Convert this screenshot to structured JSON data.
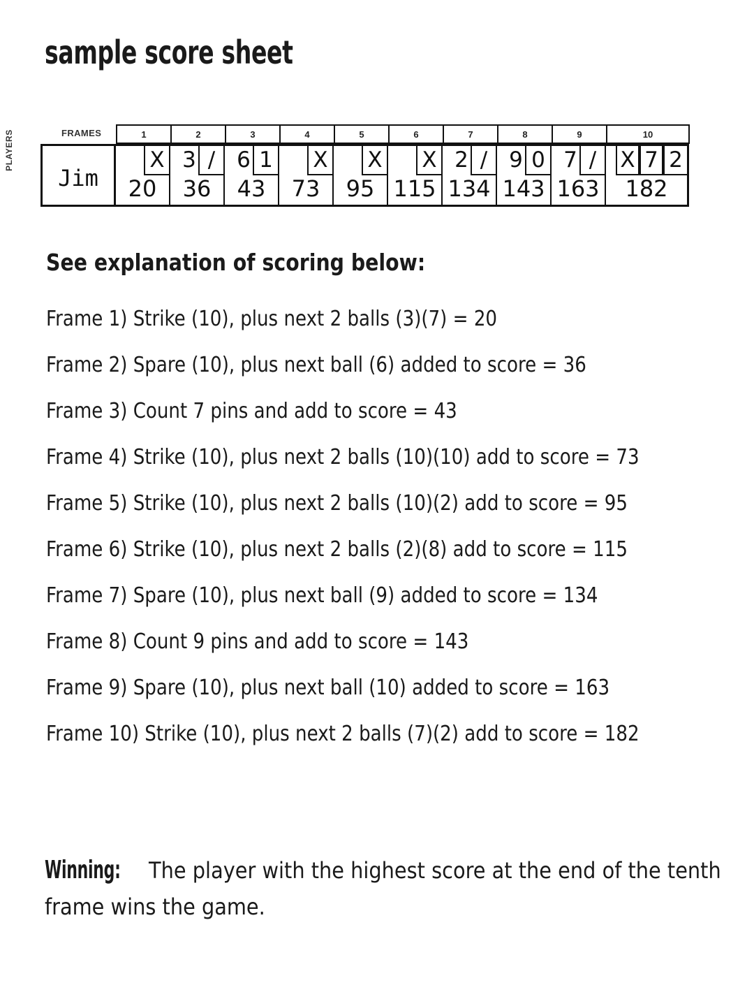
{
  "title": "sample score sheet",
  "scoresheet": {
    "players_label": "PLAYERS",
    "frames_label": "FRAMES",
    "player_name": "Jim",
    "frame_numbers": [
      "1",
      "2",
      "3",
      "4",
      "5",
      "6",
      "7",
      "8",
      "9",
      "10"
    ],
    "frames": [
      {
        "number": "1",
        "ball1": "",
        "ball2": "X",
        "total": "20"
      },
      {
        "number": "2",
        "ball1": "3",
        "ball2": "/",
        "total": "36"
      },
      {
        "number": "3",
        "ball1": "6",
        "ball2": "1",
        "total": "43"
      },
      {
        "number": "4",
        "ball1": "",
        "ball2": "X",
        "total": "73"
      },
      {
        "number": "5",
        "ball1": "",
        "ball2": "X",
        "total": "95"
      },
      {
        "number": "6",
        "ball1": "",
        "ball2": "X",
        "total": "115"
      },
      {
        "number": "7",
        "ball1": "2",
        "ball2": "/",
        "total": "134"
      },
      {
        "number": "8",
        "ball1": "9",
        "ball2": "0",
        "total": "143"
      },
      {
        "number": "9",
        "ball1": "7",
        "ball2": "/",
        "total": "163"
      },
      {
        "number": "10",
        "ball1": "X",
        "ball2": "7",
        "ball3": "2",
        "total": "182"
      }
    ]
  },
  "explanation": {
    "heading": "See explanation of scoring below:",
    "lines": [
      "Frame 1) Strike (10), plus next 2 balls (3)(7) = 20",
      "Frame 2) Spare (10), plus next ball (6) added to score = 36",
      "Frame 3) Count 7 pins and add to score = 43",
      "Frame 4) Strike (10), plus next 2 balls (10)(10) add to score = 73",
      "Frame 5) Strike (10), plus next 2 balls (10)(2) add to score = 95",
      "Frame 6) Strike (10), plus next 2 balls (2)(8) add to score = 115",
      "Frame 7) Spare (10), plus next ball (9) added to score = 134",
      "Frame 8) Count 9 pins and add to score = 143",
      "Frame 9) Spare (10), plus next ball (10) added to score = 163",
      "Frame 10) Strike (10), plus next 2 balls (7)(2) add to score = 182"
    ]
  },
  "winning": {
    "label": "Winning:",
    "text": " The player with the highest score at the end of the tenth frame wins the game."
  },
  "colors": {
    "ink": "#1a1a1a",
    "rule": "#111111",
    "paper": "#ffffff"
  }
}
